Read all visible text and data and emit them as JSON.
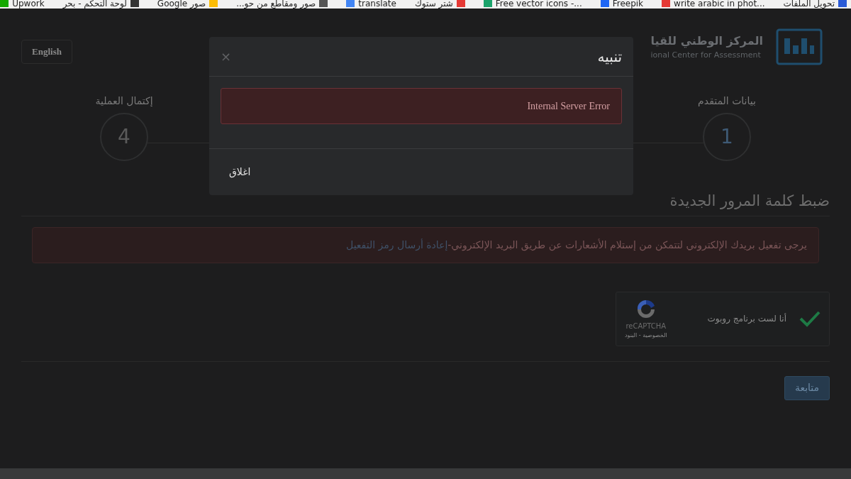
{
  "bookmarks": [
    {
      "label": "تحويل الملفات",
      "color": "#2a5bd7"
    },
    {
      "label": "write arabic in phot...",
      "color": "#e53935"
    },
    {
      "label": "Freepik",
      "color": "#1e66f5"
    },
    {
      "label": "Free vector icons -...",
      "color": "#1aa36b"
    },
    {
      "label": "شتر ستوك",
      "color": "#e53935"
    },
    {
      "label": "translate",
      "color": "#4285f4"
    },
    {
      "label": "صور ومقاطع من حو...",
      "color": "#555555"
    },
    {
      "label": "صور Google",
      "color": "#fbbc04"
    },
    {
      "label": "لوحة التحكم - بحر",
      "color": "#333333"
    },
    {
      "label": "Upwork",
      "color": "#14a800"
    }
  ],
  "language_button": "English",
  "logo": {
    "title": "المركز الوطني للقيا",
    "subtitle": "ional Center for Assessment"
  },
  "steps": [
    {
      "number": "1",
      "label": "بيانات المتقدم",
      "active": true
    },
    {
      "number": "4",
      "label": "إكتمال العملية",
      "active": false
    }
  ],
  "heading": "ضبط كلمة المرور الجديدة",
  "alert": {
    "text": "يرجى تفعيل بريدك الإلكتروني لتتمكن من إستلام الأشعارات عن طريق البريد الإلكتروني-",
    "link": "إعادة أرسال رمز التفعيل"
  },
  "captcha": {
    "label": "أنا لست برنامج روبوت",
    "checked": true,
    "brand": "reCAPTCHA",
    "terms": "الخصوصية - البنود"
  },
  "submit_button": "متابعة",
  "modal": {
    "title": "تنبيه",
    "close": "×",
    "error": "Internal Server Error",
    "button": "اغلاق"
  }
}
